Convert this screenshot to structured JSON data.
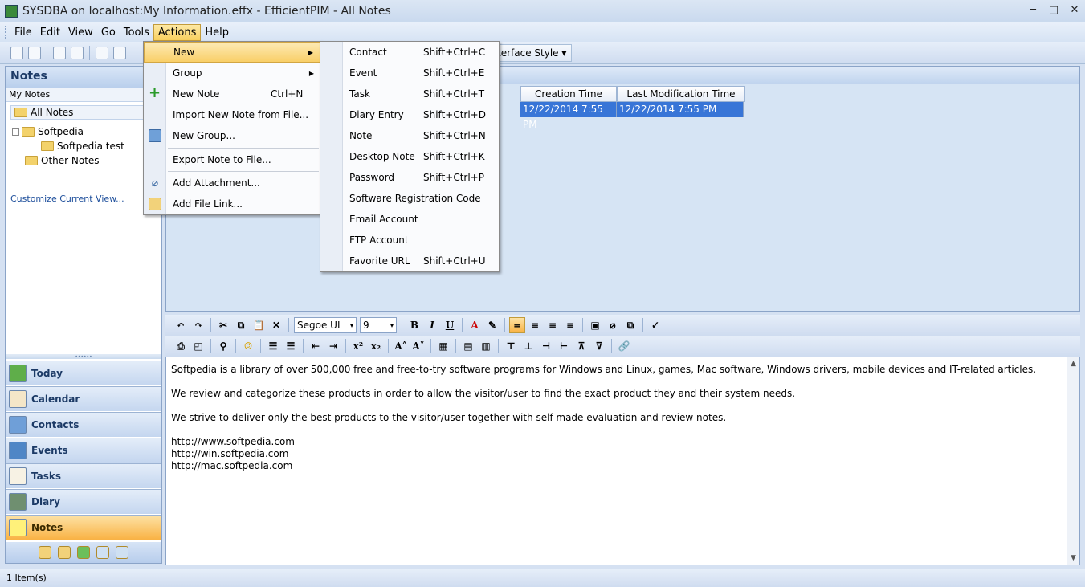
{
  "window": {
    "title": "SYSDBA on localhost:My Information.effx - EfficientPIM - All Notes",
    "minimize": "─",
    "maximize": "□",
    "close": "✕"
  },
  "menubar": {
    "file": "File",
    "edit": "Edit",
    "view": "View",
    "go": "Go",
    "tools": "Tools",
    "actions": "Actions",
    "help": "Help"
  },
  "toolbar": {
    "interface_style": "terface Style ▾"
  },
  "leftpane": {
    "header": "Notes",
    "subheader": "My Notes",
    "all_notes": "All Notes",
    "tree": {
      "softpedia": "Softpedia",
      "softpedia_test": "Softpedia test",
      "other_notes": "Other Notes"
    },
    "customize": "Customize Current View...",
    "split_grip": "••••••"
  },
  "nav": {
    "today": "Today",
    "calendar": "Calendar",
    "contacts": "Contacts",
    "events": "Events",
    "tasks": "Tasks",
    "diary": "Diary",
    "notes": "Notes"
  },
  "grid": {
    "columns": [
      "Creation Time",
      "Last Modification Time"
    ],
    "rows": [
      [
        "12/22/2014 7:55 PM",
        "12/22/2014 7:55 PM"
      ]
    ]
  },
  "editor_toolbar": {
    "font": "Segoe UI",
    "size": "9",
    "bold": "B",
    "italic": "I",
    "underline": "U",
    "superscript": "x²",
    "subscript": "x₂"
  },
  "editor": {
    "paragraphs": [
      "Softpedia is a library of over 500,000 free and free-to-try software programs for Windows and Linux, games, Mac software, Windows drivers, mobile devices and IT-related articles.",
      "We review and categorize these products in order to allow the visitor/user to find the exact product they and their system needs.",
      "We strive to deliver only the best products to the visitor/user together with self-made evaluation and review notes."
    ],
    "links": [
      "http://www.softpedia.com",
      "http://win.softpedia.com",
      "http://mac.softpedia.com"
    ]
  },
  "statusbar": {
    "items": "1 Item(s)"
  },
  "actions_menu": {
    "new": "New",
    "group": "Group",
    "new_note": "New Note",
    "new_note_shortcut": "Ctrl+N",
    "import_note": "Import New Note from File...",
    "new_group": "New Group...",
    "export_note": "Export Note to File...",
    "add_attachment": "Add Attachment...",
    "add_file_link": "Add File Link..."
  },
  "new_menu": [
    {
      "label": "Contact",
      "shortcut": "Shift+Ctrl+C"
    },
    {
      "label": "Event",
      "shortcut": "Shift+Ctrl+E"
    },
    {
      "label": "Task",
      "shortcut": "Shift+Ctrl+T"
    },
    {
      "label": "Diary Entry",
      "shortcut": "Shift+Ctrl+D"
    },
    {
      "label": "Note",
      "shortcut": "Shift+Ctrl+N"
    },
    {
      "label": "Desktop Note",
      "shortcut": "Shift+Ctrl+K"
    },
    {
      "label": "Password",
      "shortcut": "Shift+Ctrl+P"
    },
    {
      "label": "Software Registration Code",
      "shortcut": ""
    },
    {
      "label": "Email Account",
      "shortcut": ""
    },
    {
      "label": "FTP Account",
      "shortcut": ""
    },
    {
      "label": "Favorite URL",
      "shortcut": "Shift+Ctrl+U"
    }
  ],
  "colors": {
    "selection": "#3875d7",
    "highlight": "#f9cf68",
    "accent": "#1c3a66"
  }
}
